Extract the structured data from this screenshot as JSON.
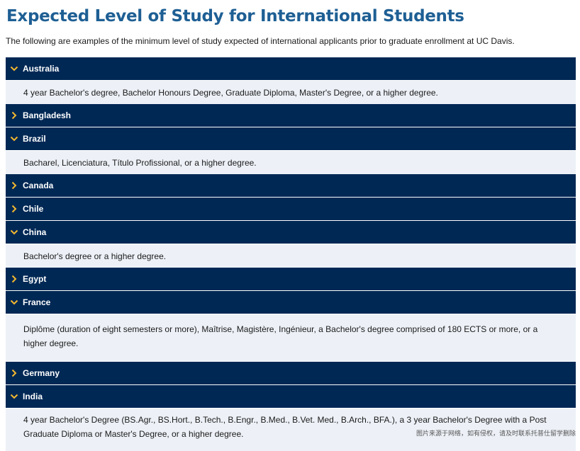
{
  "heading": "Expected Level of Study for International Students",
  "intro": "The following are examples of the minimum level of study expected of international applicants prior to graduate enrollment at UC Davis.",
  "countries": [
    {
      "name": "Australia",
      "expanded": true,
      "detail": "4 year Bachelor's degree, Bachelor Honours Degree, Graduate Diploma, Master's Degree, or a higher degree."
    },
    {
      "name": "Bangladesh",
      "expanded": false
    },
    {
      "name": "Brazil",
      "expanded": true,
      "detail": "Bacharel, Licenciatura, Título Profissional, or a higher degree."
    },
    {
      "name": "Canada",
      "expanded": false
    },
    {
      "name": "Chile",
      "expanded": false
    },
    {
      "name": "China",
      "expanded": true,
      "detail": "Bachelor's degree or a higher degree."
    },
    {
      "name": "Egypt",
      "expanded": false
    },
    {
      "name": "France",
      "expanded": true,
      "detail": "Diplôme (duration of eight semesters or more), Maîtrise, Magistère, Ingénieur, a Bachelor's degree comprised of 180 ECTS or more, or a higher degree."
    },
    {
      "name": "Germany",
      "expanded": false
    },
    {
      "name": "India",
      "expanded": true,
      "detail": "4 year Bachelor's Degree (BS.Agr., BS.Hort., B.Tech., B.Engr., B.Med., B.Vet. Med., B.Arch., BFA.), a 3 year Bachelor's Degree with a Post Graduate Diploma or Master's Degree, or a higher degree."
    }
  ],
  "watermark": "图片来源于网络，如有侵权，请及时联系托普仕留学删除",
  "colors": {
    "header_bg": "#002855",
    "chevron": "#f3b82f",
    "panel_bg": "#edf1f7",
    "title": "#1e5f94"
  }
}
